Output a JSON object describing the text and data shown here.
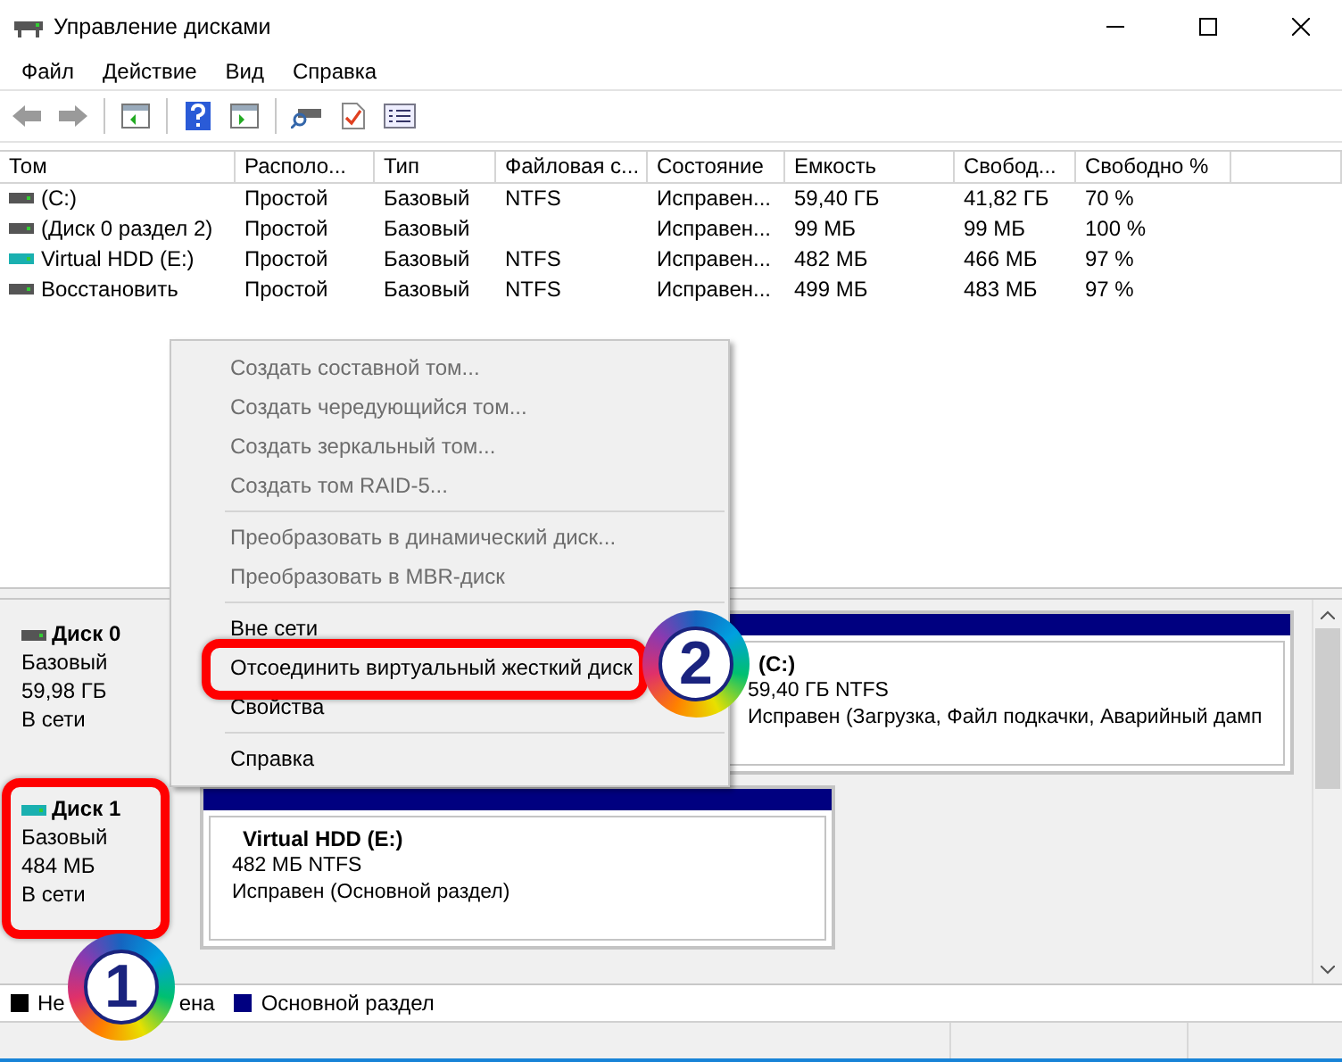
{
  "window": {
    "title": "Управление дисками"
  },
  "menu": [
    "Файл",
    "Действие",
    "Вид",
    "Справка"
  ],
  "table": {
    "columns": [
      "Том",
      "Располо...",
      "Тип",
      "Файловая с...",
      "Состояние",
      "Емкость",
      "Свобод...",
      "Свободно %"
    ],
    "rows": [
      {
        "virtual": false,
        "cells": [
          "(C:)",
          "Простой",
          "Базовый",
          "NTFS",
          "Исправен...",
          "59,40 ГБ",
          "41,82 ГБ",
          "70 %"
        ]
      },
      {
        "virtual": false,
        "cells": [
          "(Диск 0 раздел 2)",
          "Простой",
          "Базовый",
          "",
          "Исправен...",
          "99 МБ",
          "99 МБ",
          "100 %"
        ]
      },
      {
        "virtual": true,
        "cells": [
          "Virtual HDD (E:)",
          "Простой",
          "Базовый",
          "NTFS",
          "Исправен...",
          "482 МБ",
          "466 МБ",
          "97 %"
        ]
      },
      {
        "virtual": false,
        "cells": [
          "Восстановить",
          "Простой",
          "Базовый",
          "NTFS",
          "Исправен...",
          "499 МБ",
          "483 МБ",
          "97 %"
        ]
      }
    ]
  },
  "disks": [
    {
      "name": "Диск 0",
      "type": "Базовый",
      "size": "59,98 ГБ",
      "status": "В сети",
      "virtual": false,
      "partitions": [
        {
          "name": "(C:)",
          "size": "59,40 ГБ NTFS",
          "status": "Исправен (Загрузка, Файл подкачки, Аварийный дамп"
        }
      ]
    },
    {
      "name": "Диск 1",
      "type": "Базовый",
      "size": "484 МБ",
      "status": "В сети",
      "virtual": true,
      "partitions": [
        {
          "name": "Virtual HDD  (E:)",
          "size": "482 МБ NTFS",
          "status": "Исправен (Основной раздел)"
        }
      ]
    }
  ],
  "legend": [
    {
      "label": "Не",
      "label_tail": "ена",
      "color": "#000000"
    },
    {
      "label": "Основной раздел",
      "color": "#000080"
    }
  ],
  "context_menu": [
    {
      "kind": "item",
      "label": "Создать составной том...",
      "disabled": true
    },
    {
      "kind": "item",
      "label": "Создать чередующийся том...",
      "disabled": true
    },
    {
      "kind": "item",
      "label": "Создать зеркальный том...",
      "disabled": true
    },
    {
      "kind": "item",
      "label": "Создать том RAID-5...",
      "disabled": true
    },
    {
      "kind": "separator"
    },
    {
      "kind": "item",
      "label": "Преобразовать в динамический диск...",
      "disabled": true
    },
    {
      "kind": "item",
      "label": "Преобразовать в MBR-диск",
      "disabled": true
    },
    {
      "kind": "separator"
    },
    {
      "kind": "item",
      "label": "Вне сети",
      "disabled": false
    },
    {
      "kind": "item",
      "label": "Отсоединить виртуальный жесткий диск",
      "disabled": false
    },
    {
      "kind": "item",
      "label": "Свойства",
      "disabled": false
    },
    {
      "kind": "separator"
    },
    {
      "kind": "item",
      "label": "Справка",
      "disabled": false
    }
  ],
  "annotations": [
    {
      "number": "1"
    },
    {
      "number": "2"
    }
  ]
}
